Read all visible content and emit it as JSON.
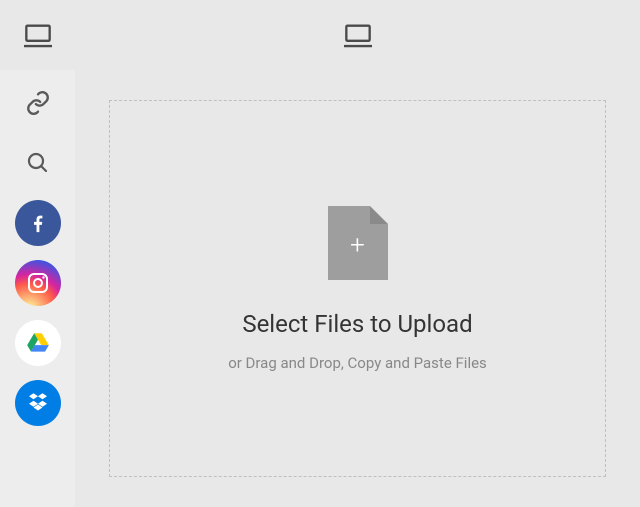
{
  "header": {
    "left_device": "desktop",
    "center_device": "desktop"
  },
  "sidebar": {
    "items": [
      {
        "name": "link",
        "label": "Link"
      },
      {
        "name": "search",
        "label": "Search"
      },
      {
        "name": "facebook",
        "label": "Facebook"
      },
      {
        "name": "instagram",
        "label": "Instagram"
      },
      {
        "name": "googledrive",
        "label": "Google Drive"
      },
      {
        "name": "dropbox",
        "label": "Dropbox"
      }
    ]
  },
  "dropzone": {
    "title": "Select Files to Upload",
    "subtitle": "or Drag and Drop, Copy and Paste Files"
  },
  "colors": {
    "page_bg": "#e8e8e8",
    "sidebar_bg": "#ededed",
    "dash_border": "#bfbfbf",
    "file_icon": "#9e9e9e",
    "title": "#343434",
    "subtitle": "#888888",
    "facebook": "#39579a",
    "dropbox": "#007ee5"
  }
}
